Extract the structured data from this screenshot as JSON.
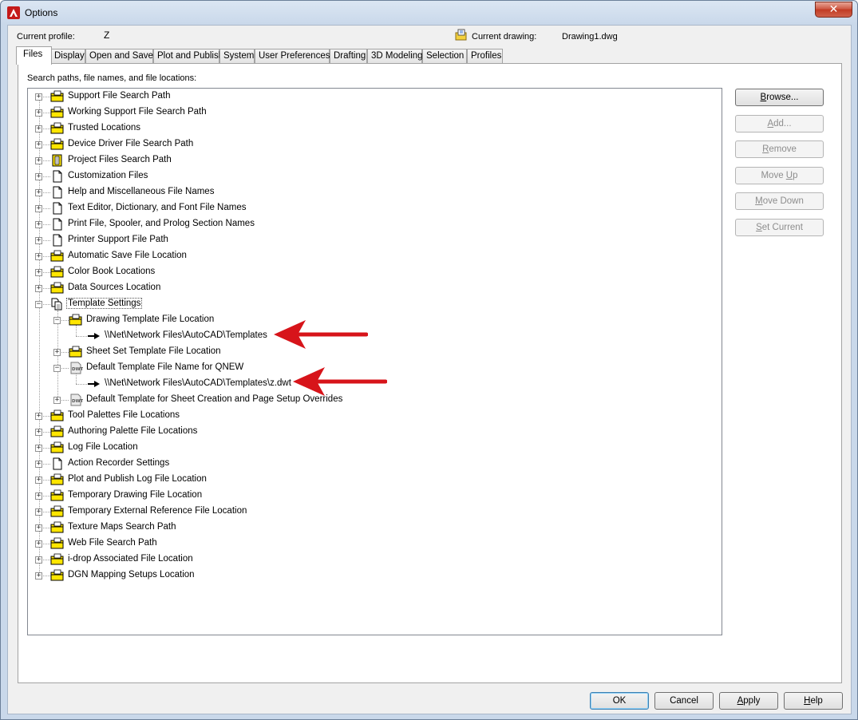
{
  "window": {
    "title": "Options"
  },
  "profile": {
    "label": "Current profile:",
    "value": "Z",
    "drawing_label": "Current drawing:",
    "drawing_value": "Drawing1.dwg"
  },
  "tabs": [
    {
      "label": "Files"
    },
    {
      "label": "Display"
    },
    {
      "label": "Open and Save"
    },
    {
      "label": "Plot and Publish"
    },
    {
      "label": "System"
    },
    {
      "label": "User Preferences"
    },
    {
      "label": "Drafting"
    },
    {
      "label": "3D Modeling"
    },
    {
      "label": "Selection"
    },
    {
      "label": "Profiles"
    }
  ],
  "panel": {
    "label": "Search paths, file names, and file locations:"
  },
  "tree": {
    "items": [
      {
        "label": "Support File Search Path",
        "icon": "folder-search-icon",
        "level": 0,
        "state": "collapsed"
      },
      {
        "label": "Working Support File Search Path",
        "icon": "folder-search-icon",
        "level": 0,
        "state": "collapsed"
      },
      {
        "label": "Trusted Locations",
        "icon": "folder-search-icon",
        "level": 0,
        "state": "collapsed"
      },
      {
        "label": "Device Driver File Search Path",
        "icon": "folder-search-icon",
        "level": 0,
        "state": "collapsed"
      },
      {
        "label": "Project Files Search Path",
        "icon": "project-icon",
        "level": 0,
        "state": "collapsed"
      },
      {
        "label": "Customization Files",
        "icon": "document-icon",
        "level": 0,
        "state": "collapsed"
      },
      {
        "label": "Help and Miscellaneous File Names",
        "icon": "document-icon",
        "level": 0,
        "state": "collapsed"
      },
      {
        "label": "Text Editor, Dictionary, and Font File Names",
        "icon": "document-icon",
        "level": 0,
        "state": "collapsed"
      },
      {
        "label": "Print File, Spooler, and Prolog Section Names",
        "icon": "document-icon",
        "level": 0,
        "state": "collapsed"
      },
      {
        "label": "Printer Support File Path",
        "icon": "document-icon",
        "level": 0,
        "state": "collapsed"
      },
      {
        "label": "Automatic Save File Location",
        "icon": "folder-search-icon",
        "level": 0,
        "state": "collapsed"
      },
      {
        "label": "Color Book Locations",
        "icon": "folder-search-icon",
        "level": 0,
        "state": "collapsed"
      },
      {
        "label": "Data Sources Location",
        "icon": "folder-search-icon",
        "level": 0,
        "state": "collapsed"
      },
      {
        "label": "Template Settings",
        "icon": "template-settings-icon",
        "level": 0,
        "state": "expanded",
        "selected": true
      },
      {
        "label": "Drawing Template File Location",
        "icon": "folder-search-icon",
        "level": 1,
        "state": "expanded"
      },
      {
        "label": "\\\\Net\\Network Files\\AutoCAD\\Templates",
        "icon": "path-arrow-icon",
        "level": 2,
        "state": "leaf"
      },
      {
        "label": "Sheet Set Template File Location",
        "icon": "folder-search-icon",
        "level": 1,
        "state": "collapsed"
      },
      {
        "label": "Default Template File Name for QNEW",
        "icon": "dwt-file-icon",
        "level": 1,
        "state": "expanded"
      },
      {
        "label": "\\\\Net\\Network Files\\AutoCAD\\Templates\\z.dwt",
        "icon": "path-arrow-icon",
        "level": 2,
        "state": "leaf"
      },
      {
        "label": "Default Template for Sheet Creation and Page Setup Overrides",
        "icon": "dwt-file-icon",
        "level": 1,
        "state": "collapsed"
      },
      {
        "label": "Tool Palettes File Locations",
        "icon": "folder-search-icon",
        "level": 0,
        "state": "collapsed"
      },
      {
        "label": "Authoring Palette File Locations",
        "icon": "folder-search-icon",
        "level": 0,
        "state": "collapsed"
      },
      {
        "label": "Log File Location",
        "icon": "folder-search-icon",
        "level": 0,
        "state": "collapsed"
      },
      {
        "label": "Action Recorder Settings",
        "icon": "document-icon",
        "level": 0,
        "state": "collapsed"
      },
      {
        "label": "Plot and Publish Log File Location",
        "icon": "folder-search-icon",
        "level": 0,
        "state": "collapsed"
      },
      {
        "label": "Temporary Drawing File Location",
        "icon": "folder-search-icon",
        "level": 0,
        "state": "collapsed"
      },
      {
        "label": "Temporary External Reference File Location",
        "icon": "folder-search-icon",
        "level": 0,
        "state": "collapsed"
      },
      {
        "label": "Texture Maps Search Path",
        "icon": "folder-search-icon",
        "level": 0,
        "state": "collapsed"
      },
      {
        "label": "Web File Search Path",
        "icon": "folder-search-icon",
        "level": 0,
        "state": "collapsed"
      },
      {
        "label": "i-drop Associated File Location",
        "icon": "folder-search-icon",
        "level": 0,
        "state": "collapsed"
      },
      {
        "label": "DGN Mapping Setups Location",
        "icon": "folder-search-icon",
        "level": 0,
        "state": "collapsed"
      }
    ]
  },
  "side_buttons": [
    {
      "name": "browse-button",
      "pre": "",
      "key": "B",
      "post": "rowse...",
      "enabled": true
    },
    {
      "name": "add-button",
      "pre": "",
      "key": "A",
      "post": "dd...",
      "enabled": false
    },
    {
      "name": "remove-button",
      "pre": "",
      "key": "R",
      "post": "emove",
      "enabled": false
    },
    {
      "name": "move-up-button",
      "pre": "Move ",
      "key": "U",
      "post": "p",
      "enabled": false
    },
    {
      "name": "move-down-button",
      "pre": "",
      "key": "M",
      "post": "ove Down",
      "enabled": false
    },
    {
      "name": "set-current-button",
      "pre": "",
      "key": "S",
      "post": "et Current",
      "enabled": false
    }
  ],
  "footer_buttons": {
    "ok": "OK",
    "cancel": "Cancel",
    "apply_pre": "",
    "apply_key": "A",
    "apply_post": "pply",
    "help_pre": "",
    "help_key": "H",
    "help_post": "elp"
  },
  "colors": {
    "annotation_arrow": "#d7141a",
    "folder_yellow": "#ffe600",
    "default_button_border": "#3c7fb1"
  }
}
